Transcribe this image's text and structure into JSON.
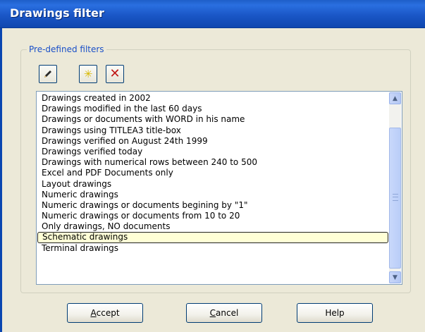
{
  "window": {
    "title": "Drawings filter"
  },
  "group": {
    "label": "Pre-defined filters"
  },
  "toolbar": {
    "edit_icon": "pencil-icon",
    "new_icon": "sparkle-new-icon",
    "delete_icon": "red-x-delete-icon"
  },
  "filters": {
    "items": [
      "Drawings created in 2002",
      "Drawings modified in the last 60 days",
      "Drawings or documents with WORD in his name",
      "Drawings using TITLEA3 title-box",
      "Drawings verified on August 24th 1999",
      "Drawings verified today",
      "Drawings with numerical rows between 240 to 500",
      "Excel and PDF Documents only",
      "Layout drawings",
      "Numeric drawings",
      "Numeric drawings or documents begining by \"1\"",
      "Numeric drawings or documents from 10 to 20",
      "Only drawings, NO documents",
      "Schematic drawings",
      "Terminal drawings"
    ],
    "selected": "Schematic drawings"
  },
  "buttons": {
    "accept_hotkey": "A",
    "accept_rest": "ccept",
    "cancel_hotkey": "C",
    "cancel_rest": "ancel",
    "help": "Help"
  }
}
